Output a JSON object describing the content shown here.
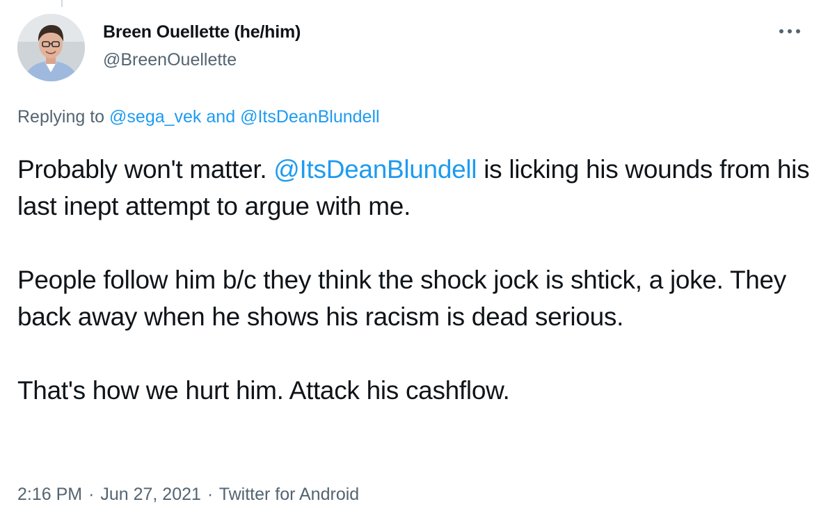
{
  "tweet": {
    "author": {
      "display_name": "Breen Ouellette (he/him)",
      "handle": "@BreenOuellette"
    },
    "reply_to": {
      "prefix": "Replying to",
      "user1": "@sega_vek",
      "conjunction": "and",
      "user2": "@ItsDeanBlundell"
    },
    "text": {
      "p1_start": "Probably won't matter.",
      "p1_mention": "@ItsDeanBlundell",
      "p1_end": "is licking his wounds from his last inept attempt to argue with me.",
      "p2": "People follow him b/c they think the shock jock is shtick, a joke. They back away when he shows his racism is dead serious.",
      "p3": "That's how we hurt him. Attack his cashflow."
    },
    "meta": {
      "time": "2:16 PM",
      "separator": "·",
      "date": "Jun 27, 2021",
      "source": "Twitter for Android"
    },
    "icons": {
      "more": "more-horizontal-icon"
    },
    "colors": {
      "text": "#0f1419",
      "secondary": "#536471",
      "link": "#1d9bf0"
    }
  }
}
